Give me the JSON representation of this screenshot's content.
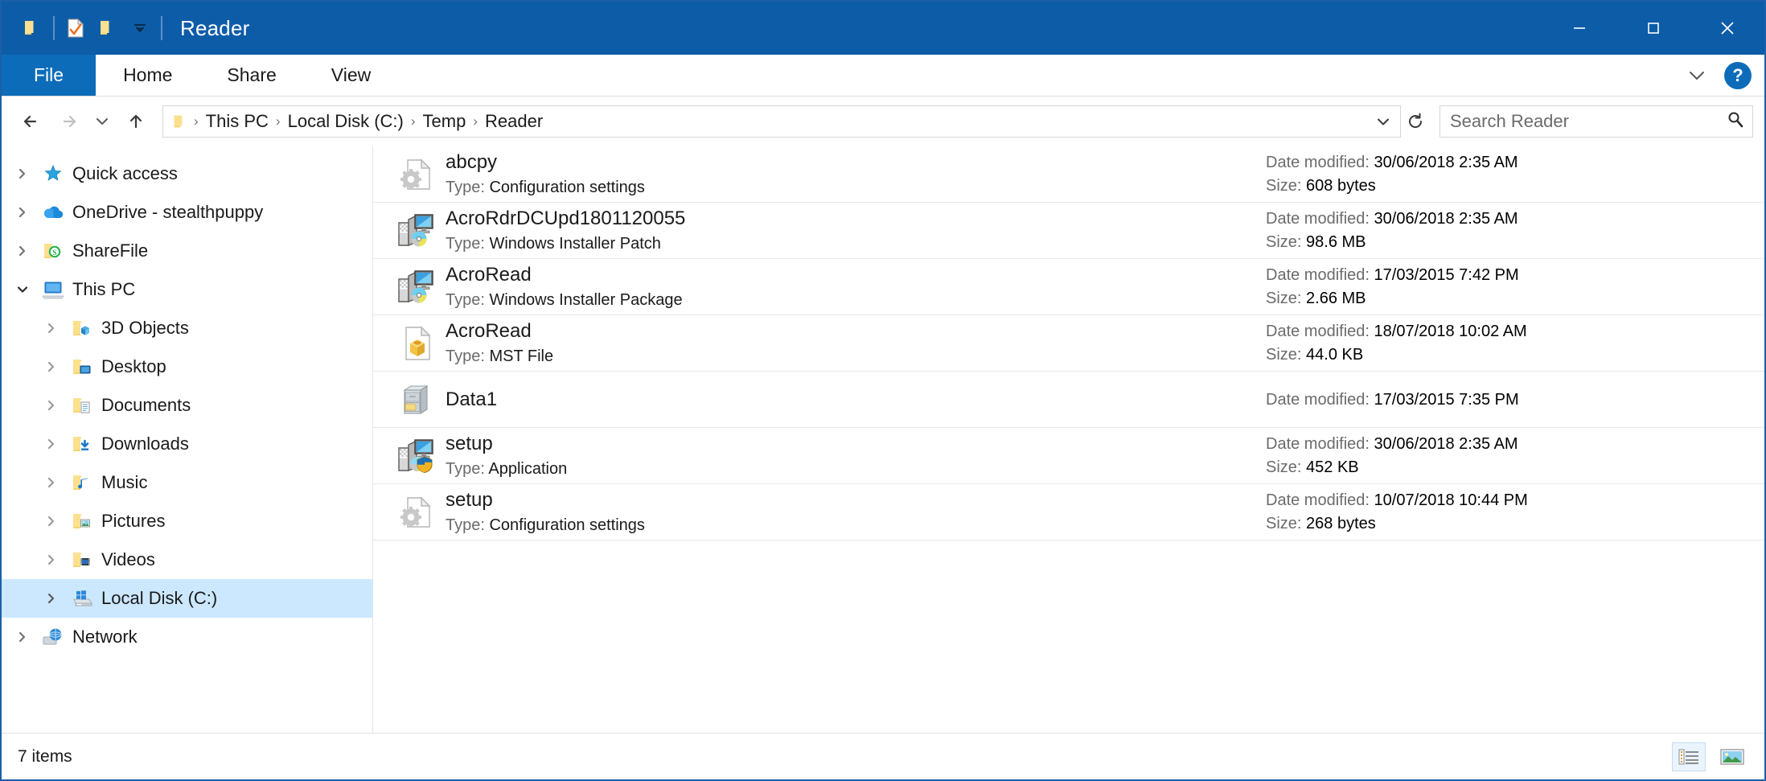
{
  "window": {
    "title": "Reader",
    "quick_access": [
      {
        "name": "folder-icon",
        "label": "Folder"
      },
      {
        "name": "properties-icon",
        "label": "Properties"
      },
      {
        "name": "new-folder-icon",
        "label": "New folder"
      },
      {
        "name": "customize-qat-chevron-icon",
        "label": "Customize Quick Access Toolbar"
      }
    ],
    "controls": {
      "minimize": "—",
      "maximize": "□",
      "close": "✕"
    }
  },
  "ribbon": {
    "tabs": [
      {
        "label": "File",
        "active": true
      },
      {
        "label": "Home",
        "active": false
      },
      {
        "label": "Share",
        "active": false
      },
      {
        "label": "View",
        "active": false
      }
    ],
    "expand_label": "⌄",
    "help_label": "?"
  },
  "address": {
    "back": "←",
    "forward": "→",
    "recent": "⌄",
    "up": "↑",
    "crumbs": [
      "This PC",
      "Local Disk (C:)",
      "Temp",
      "Reader"
    ],
    "separator": "›",
    "dropdown": "⌄",
    "refresh": "↻"
  },
  "search": {
    "value": "",
    "placeholder": "Search Reader"
  },
  "navpane": {
    "items": [
      {
        "label": "Quick access",
        "icon": "star-icon",
        "level": 1,
        "expanded": false,
        "selected": false
      },
      {
        "label": "OneDrive - stealthpuppy",
        "icon": "cloud-icon",
        "level": 1,
        "expanded": false,
        "selected": false
      },
      {
        "label": "ShareFile",
        "icon": "sharefile-icon",
        "level": 1,
        "expanded": false,
        "selected": false
      },
      {
        "label": "This PC",
        "icon": "computer-icon",
        "level": 1,
        "expanded": true,
        "selected": false
      },
      {
        "label": "3D Objects",
        "icon": "folder-3d-icon",
        "level": 2,
        "expanded": false,
        "selected": false
      },
      {
        "label": "Desktop",
        "icon": "folder-desktop-icon",
        "level": 2,
        "expanded": false,
        "selected": false
      },
      {
        "label": "Documents",
        "icon": "folder-docs-icon",
        "level": 2,
        "expanded": false,
        "selected": false
      },
      {
        "label": "Downloads",
        "icon": "folder-dl-icon",
        "level": 2,
        "expanded": false,
        "selected": false
      },
      {
        "label": "Music",
        "icon": "folder-music-icon",
        "level": 2,
        "expanded": false,
        "selected": false
      },
      {
        "label": "Pictures",
        "icon": "folder-pics-icon",
        "level": 2,
        "expanded": false,
        "selected": false
      },
      {
        "label": "Videos",
        "icon": "folder-video-icon",
        "level": 2,
        "expanded": false,
        "selected": false
      },
      {
        "label": "Local Disk (C:)",
        "icon": "drive-icon",
        "level": 2,
        "expanded": false,
        "selected": true
      },
      {
        "label": "Network",
        "icon": "network-icon",
        "level": 1,
        "expanded": false,
        "selected": false
      }
    ]
  },
  "filelist": {
    "type_label": "Type:",
    "date_label": "Date modified:",
    "size_label": "Size:",
    "rows": [
      {
        "name": "abcpy",
        "icon": "config-file-icon",
        "type": "Configuration settings",
        "date": "30/06/2018 2:35 AM",
        "size": "608 bytes"
      },
      {
        "name": "AcroRdrDCUpd1801120055",
        "icon": "msi-patch-icon",
        "type": "Windows Installer Patch",
        "date": "30/06/2018 2:35 AM",
        "size": "98.6 MB"
      },
      {
        "name": "AcroRead",
        "icon": "msi-package-icon",
        "type": "Windows Installer Package",
        "date": "17/03/2015 7:42 PM",
        "size": "2.66 MB"
      },
      {
        "name": "AcroRead",
        "icon": "mst-file-icon",
        "type": "MST File",
        "date": "18/07/2018 10:02 AM",
        "size": "44.0 KB"
      },
      {
        "name": "Data1",
        "icon": "cabinet-file-icon",
        "type": "",
        "date": "17/03/2015 7:35 PM",
        "size": ""
      },
      {
        "name": "setup",
        "icon": "application-icon",
        "type": "Application",
        "date": "30/06/2018 2:35 AM",
        "size": "452 KB"
      },
      {
        "name": "setup",
        "icon": "config-file-icon",
        "type": "Configuration settings",
        "date": "10/07/2018 10:44 PM",
        "size": "268 bytes"
      }
    ]
  },
  "statusbar": {
    "item_count": "7 items",
    "views": [
      {
        "name": "details-view-button",
        "active": true
      },
      {
        "name": "large-icons-view-button",
        "active": false
      }
    ]
  },
  "colors": {
    "titlebar": "#0d5ca8",
    "file_tab": "#0d6cb9",
    "selection": "#cce8ff",
    "accent": "#0078d7"
  }
}
